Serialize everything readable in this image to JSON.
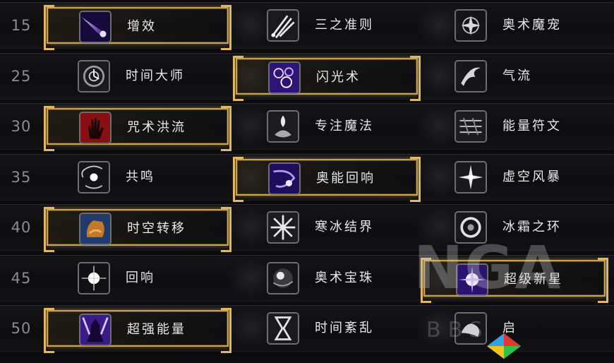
{
  "rows": [
    {
      "level": "15",
      "talents": [
        {
          "name": "增效",
          "icon": "arcane-comet-icon",
          "selected": true
        },
        {
          "name": "三之准则",
          "icon": "arcane-missiles-icon",
          "selected": false
        },
        {
          "name": "奥术魔宠",
          "icon": "arcane-familiar-icon",
          "selected": false
        }
      ]
    },
    {
      "level": "25",
      "talents": [
        {
          "name": "时间大师",
          "icon": "clockwork-icon",
          "selected": false
        },
        {
          "name": "闪光术",
          "icon": "shimmer-icon",
          "selected": true
        },
        {
          "name": "气流",
          "icon": "slipstream-icon",
          "selected": false
        }
      ]
    },
    {
      "level": "30",
      "talents": [
        {
          "name": "咒术洪流",
          "icon": "red-hand-icon",
          "selected": true
        },
        {
          "name": "专注魔法",
          "icon": "focus-magic-icon",
          "selected": false
        },
        {
          "name": "能量符文",
          "icon": "rune-icon",
          "selected": false
        }
      ]
    },
    {
      "level": "35",
      "talents": [
        {
          "name": "共鸣",
          "icon": "resonance-icon",
          "selected": false
        },
        {
          "name": "奥能回响",
          "icon": "arcane-echo-icon",
          "selected": true
        },
        {
          "name": "虚空风暴",
          "icon": "nether-tempest-icon",
          "selected": false
        }
      ]
    },
    {
      "level": "40",
      "talents": [
        {
          "name": "时空转移",
          "icon": "chrono-shift-icon",
          "selected": true
        },
        {
          "name": "寒冰结界",
          "icon": "frost-ward-icon",
          "selected": false
        },
        {
          "name": "冰霜之环",
          "icon": "ring-of-frost-icon",
          "selected": false
        }
      ]
    },
    {
      "level": "45",
      "talents": [
        {
          "name": "回响",
          "icon": "reverberate-icon",
          "selected": false
        },
        {
          "name": "奥术宝珠",
          "icon": "arcane-orb-icon",
          "selected": false
        },
        {
          "name": "超级新星",
          "icon": "supernova-icon",
          "selected": true
        }
      ]
    },
    {
      "level": "50",
      "talents": [
        {
          "name": "超强能量",
          "icon": "overpowered-icon",
          "selected": true
        },
        {
          "name": "时间紊乱",
          "icon": "hourglass-icon",
          "selected": false
        },
        {
          "name": "启",
          "icon": "ignite-icon",
          "selected": false
        }
      ]
    }
  ],
  "watermark": {
    "brand": "NGA",
    "sub": "BBS"
  },
  "accent_gold": "#c9a250"
}
